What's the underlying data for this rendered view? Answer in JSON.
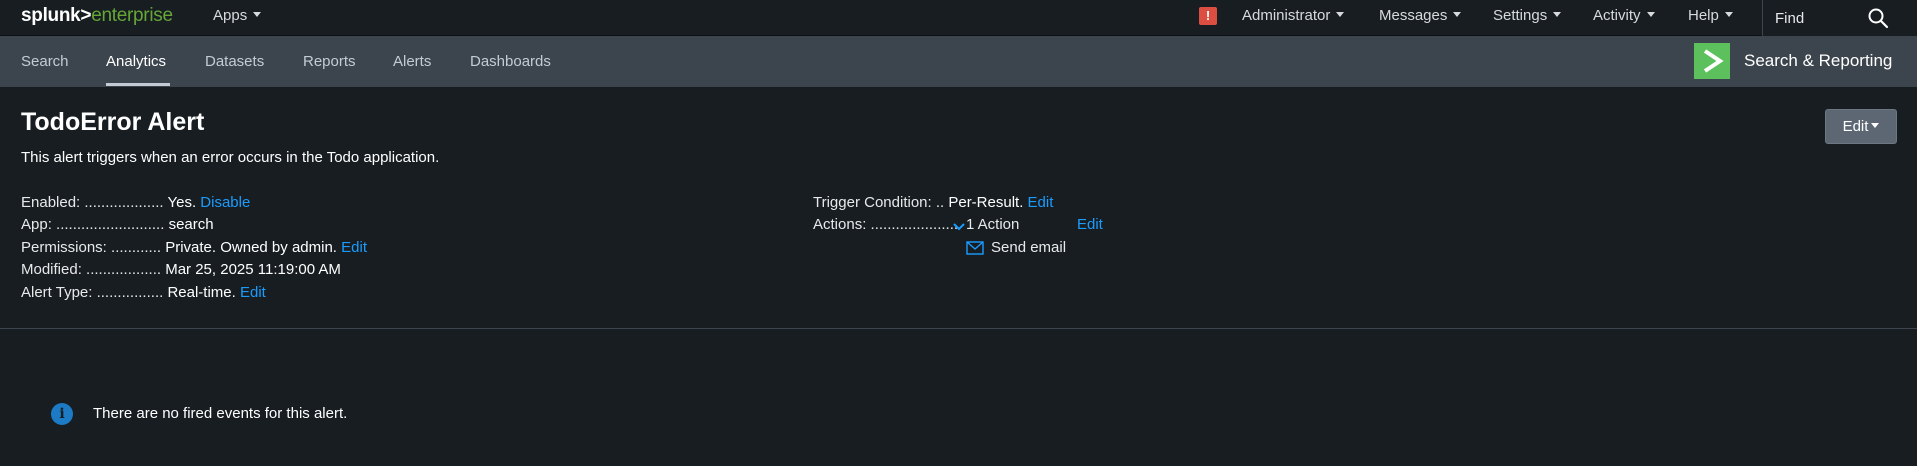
{
  "topbar": {
    "logo_part1": "splunk>",
    "logo_part2": "enterprise",
    "apps_label": "Apps",
    "alert_badge": "!",
    "menus": [
      "Administrator",
      "Messages",
      "Settings",
      "Activity",
      "Help"
    ],
    "find_placeholder": "Find"
  },
  "appbar": {
    "tabs": [
      "Search",
      "Analytics",
      "Datasets",
      "Reports",
      "Alerts",
      "Dashboards"
    ],
    "active_tab": "Analytics",
    "app_name": "Search & Reporting",
    "app_icon_glyph": ">"
  },
  "alert": {
    "title": "TodoError Alert",
    "edit_label": "Edit",
    "description": "This alert triggers when an error occurs in the Todo application.",
    "enabled_label": "Enabled: ...................",
    "enabled_value": "Yes.",
    "enabled_link": "Disable",
    "app_label": "App: ..........................",
    "app_value": "search",
    "permissions_label": "Permissions: ............",
    "permissions_value": "Private. Owned by admin.",
    "permissions_link": "Edit",
    "modified_label": "Modified: ..................",
    "modified_value": "Mar 25, 2025 11:19:00 AM",
    "alert_type_label": "Alert Type: ................",
    "alert_type_value": "Real-time.",
    "alert_type_link": "Edit",
    "trigger_label": "Trigger Condition: ..",
    "trigger_value": "Per-Result.",
    "trigger_link": "Edit",
    "actions_label": "Actions: .....................",
    "actions_value": "1 Action",
    "actions_link": "Edit",
    "action_item": "Send email"
  },
  "events": {
    "info_glyph": "i",
    "message": "There are no fired events for this alert."
  },
  "colors": {
    "background": "#171d21",
    "appbar": "#3c444d",
    "link": "#1a9cff",
    "app_icon": "#5cc05c",
    "alert_badge": "#dc4e41",
    "info": "#1c7bc4"
  }
}
